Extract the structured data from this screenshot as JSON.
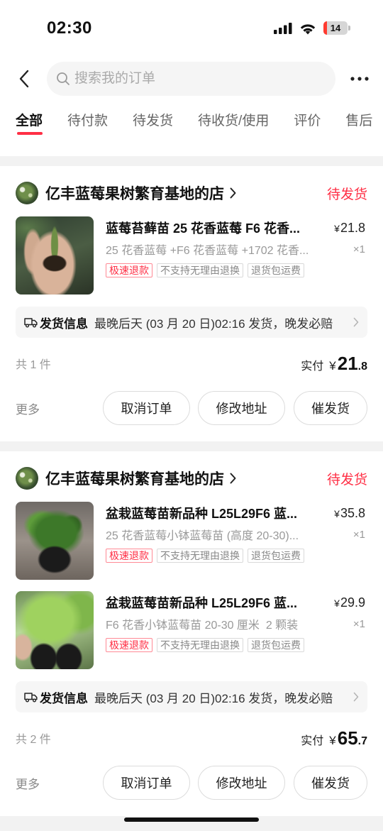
{
  "status_bar": {
    "time": "02:30",
    "battery_level": "14"
  },
  "header": {
    "search_placeholder": "搜索我的订单"
  },
  "tabs": [
    {
      "label": "全部",
      "active": true
    },
    {
      "label": "待付款",
      "active": false
    },
    {
      "label": "待发货",
      "active": false
    },
    {
      "label": "待收货/使用",
      "active": false
    },
    {
      "label": "评价",
      "active": false
    },
    {
      "label": "售后",
      "active": false
    }
  ],
  "orders": [
    {
      "shop_name": "亿丰蓝莓果树繁育基地的店",
      "status": "待发货",
      "items": [
        {
          "title": "蓝莓苔藓苗 25 花香蓝莓 F6 花香...",
          "price_currency": "¥",
          "price_amount": "21.8",
          "spec": "25 花香蓝莓 +F6 花香蓝莓 +1702 花香...",
          "quantity": "×1",
          "tags": [
            "极速退款",
            "不支持无理由退换",
            "退货包运费"
          ]
        }
      ],
      "shipping": {
        "label": "发货信息",
        "text": "最晚后天 (03 月 20 日)02:16 发货，晚发必赔"
      },
      "item_count": "共 1 件",
      "total": {
        "label": "实付",
        "currency": "¥",
        "integer": "21",
        "decimal": ".8"
      },
      "more_label": "更多",
      "actions": [
        "取消订单",
        "修改地址",
        "催发货"
      ]
    },
    {
      "shop_name": "亿丰蓝莓果树繁育基地的店",
      "status": "待发货",
      "items": [
        {
          "title": "盆栽蓝莓苗新品种 L25L29F6 蓝...",
          "price_currency": "¥",
          "price_amount": "35.8",
          "spec": "25 花香蓝莓小钵蓝莓苗 (高度 20-30)...",
          "quantity": "×1",
          "tags": [
            "极速退款",
            "不支持无理由退换",
            "退货包运费"
          ]
        },
        {
          "title": "盆栽蓝莓苗新品种 L25L29F6 蓝...",
          "price_currency": "¥",
          "price_amount": "29.9",
          "spec": "F6 花香小钵蓝莓苗 20-30 厘米  2 颗装",
          "quantity": "×1",
          "tags": [
            "极速退款",
            "不支持无理由退换",
            "退货包运费"
          ]
        }
      ],
      "shipping": {
        "label": "发货信息",
        "text": "最晚后天 (03 月 20 日)02:16 发货，晚发必赔"
      },
      "item_count": "共 2 件",
      "total": {
        "label": "实付",
        "currency": "¥",
        "integer": "65",
        "decimal": ".7"
      },
      "more_label": "更多",
      "actions": [
        "取消订单",
        "修改地址",
        "催发货"
      ]
    }
  ],
  "colors": {
    "accent": "#ff2f45",
    "text_primary": "#1a1a1a",
    "text_secondary": "#999999",
    "page_background": "#f2f2f2"
  },
  "icons": {
    "back": "chevron-left-icon",
    "search": "search-icon",
    "more": "more-dots-icon",
    "shop_link": "chevron-right-icon",
    "shipping": "truck-icon",
    "shipping_link": "chevron-right-icon"
  }
}
